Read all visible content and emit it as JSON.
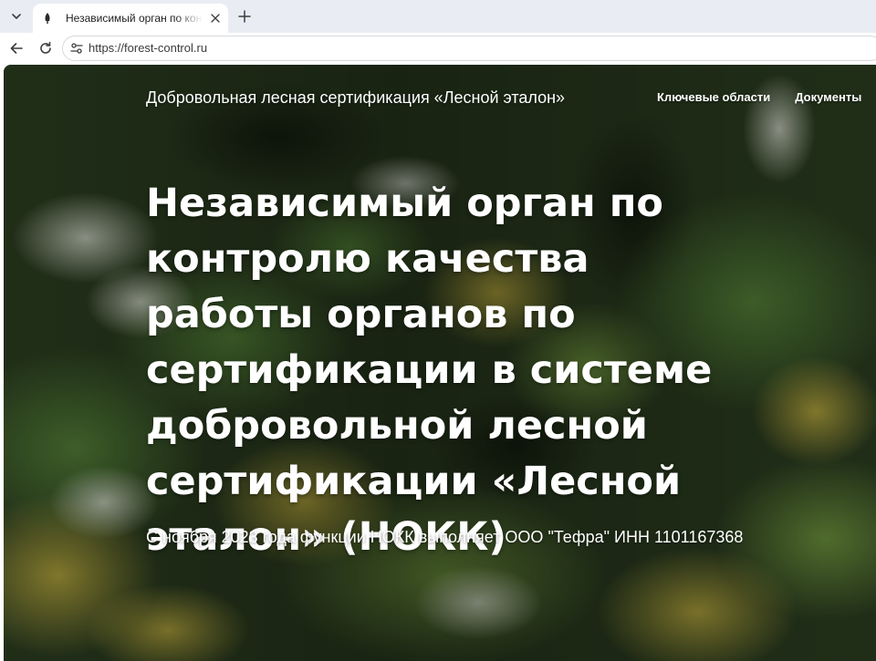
{
  "browser": {
    "tab": {
      "title": "Независимый орган по контролю качества работы органов по сертификации"
    },
    "address_bar": {
      "url": "https://forest-control.ru"
    }
  },
  "page": {
    "header": {
      "site_title": "Добровольная лесная сертификация «Лесной эталон»",
      "nav": [
        {
          "label": "Ключевые области"
        },
        {
          "label": "Документы"
        }
      ]
    },
    "hero": {
      "heading": "Независимый орган по контролю качества работы органов по сертификации в системе добровольной лесной сертификации «Лесной эталон» (НОКК)",
      "subheading": "С ноября 2023 года функции НОКК выполняет ООО \"Тефра\" ИНН 1101167368"
    }
  },
  "colors": {
    "tabstrip": "#e9edf3",
    "forest_dark": "#1f2d18",
    "forest_green": "#3d5a2a",
    "autumn_yellow": "#a88f2e",
    "text_on_image": "#ffffff"
  },
  "icons": {
    "tab_menu": "chevron-down-icon",
    "favicon": "tree-icon",
    "tab_close": "close-icon",
    "new_tab": "plus-icon",
    "back": "arrow-left-icon",
    "reload": "reload-icon",
    "site_info": "tune-icon"
  }
}
